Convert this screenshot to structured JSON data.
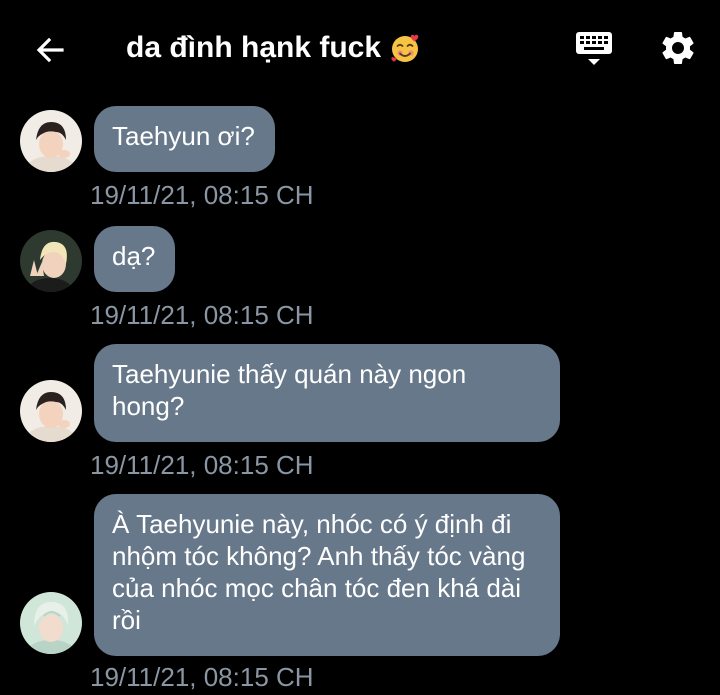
{
  "header": {
    "back_icon": "arrow-left-icon",
    "title": "da đình hạnk fuck",
    "title_emoji": "smiling-face-with-hearts",
    "keyboard_icon": "keyboard-icon",
    "settings_icon": "gear-icon"
  },
  "messages": [
    {
      "text": "Taehyun ơi?",
      "timestamp": "19/11/21, 08:15 CH",
      "avatar": "avatar-dark-hair"
    },
    {
      "text": "dạ?",
      "timestamp": "19/11/21, 08:15 CH",
      "avatar": "avatar-blond-hair"
    },
    {
      "text": "Taehyunie thấy quán này ngon\nhong?",
      "timestamp": "19/11/21, 08:15 CH",
      "avatar": "avatar-dark-hair"
    },
    {
      "text": "À Taehyunie này, nhóc có ý định đi\nnhộm tóc không? Anh thấy tóc vàng\ncủa nhóc mọc chân tóc đen khá dài\nrồi",
      "timestamp": "19/11/21, 08:15 CH",
      "avatar": "avatar-light-hair"
    }
  ],
  "colors": {
    "background": "#000000",
    "bubble": "#67788a",
    "timestamp": "#8a96a3"
  }
}
